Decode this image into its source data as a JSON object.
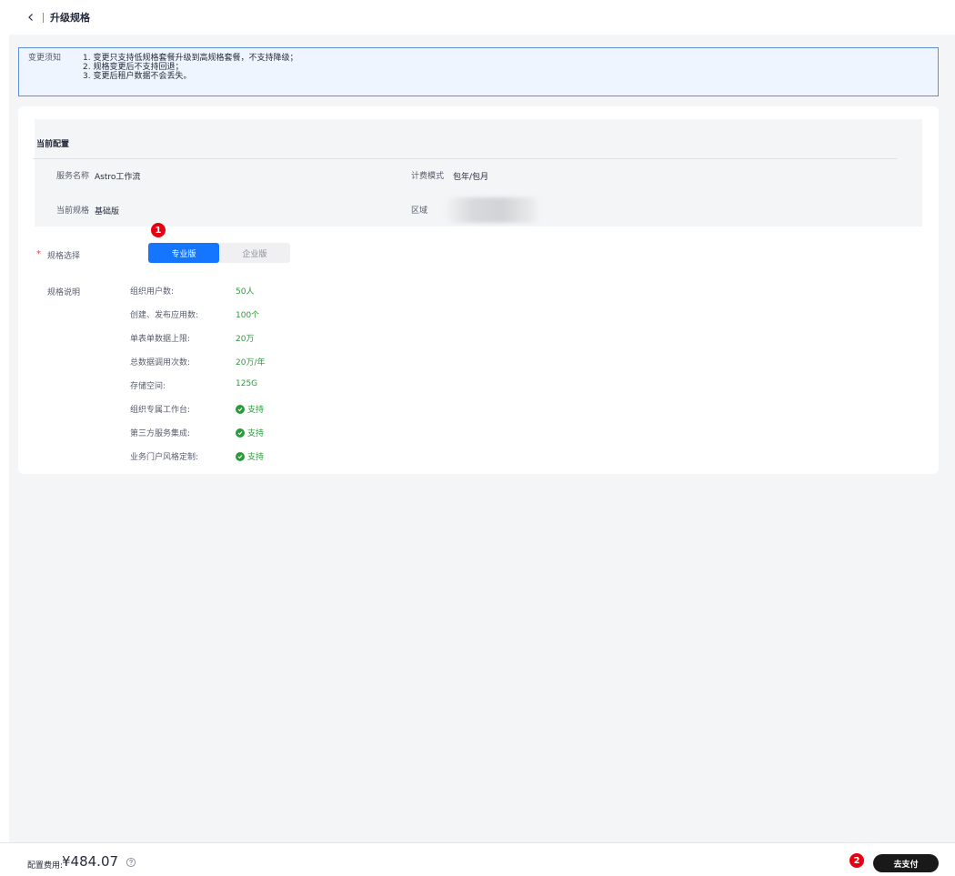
{
  "header": {
    "title": "升级规格"
  },
  "notice": {
    "label": "变更须知",
    "items": [
      "1. 变更只支持低规格套餐升级到高规格套餐，不支持降级；",
      "2. 规格变更后不支持回退；",
      "3. 变更后租户数据不会丢失。"
    ]
  },
  "config": {
    "title": "当前配置",
    "service_name_label": "服务名称",
    "service_name_value": "Astro工作流",
    "billing_label": "计费模式",
    "billing_value": "包年/包月",
    "spec_label": "当前规格",
    "spec_value": "基础版",
    "region_label": "区域"
  },
  "spec_select": {
    "required_mark": "*",
    "label": "规格选择",
    "options": [
      "专业版",
      "企业版"
    ],
    "selected": "专业版"
  },
  "spec_desc": {
    "label": "规格说明",
    "items": [
      {
        "k": "组织用户数:",
        "v": "50人"
      },
      {
        "k": "创建、发布应用数:",
        "v": "100个"
      },
      {
        "k": "单表单数据上限:",
        "v": "20万"
      },
      {
        "k": "总数据调用次数:",
        "v": "20万/年"
      },
      {
        "k": "存储空间:",
        "v": "125G"
      },
      {
        "k": "组织专属工作台:",
        "v": "支持"
      },
      {
        "k": "第三方服务集成:",
        "v": "支持"
      },
      {
        "k": "业务门户风格定制:",
        "v": "支持"
      }
    ]
  },
  "footer": {
    "fee_label": "配置费用:",
    "fee_value": "¥484.07",
    "pay_label": "去支付"
  },
  "badges": [
    "1",
    "2"
  ],
  "colors": {
    "primary": "#1476ff",
    "success": "#2a9b3a",
    "notice_border": "#5e8fd6",
    "badge": "#e60012",
    "pay_button": "#191919"
  }
}
